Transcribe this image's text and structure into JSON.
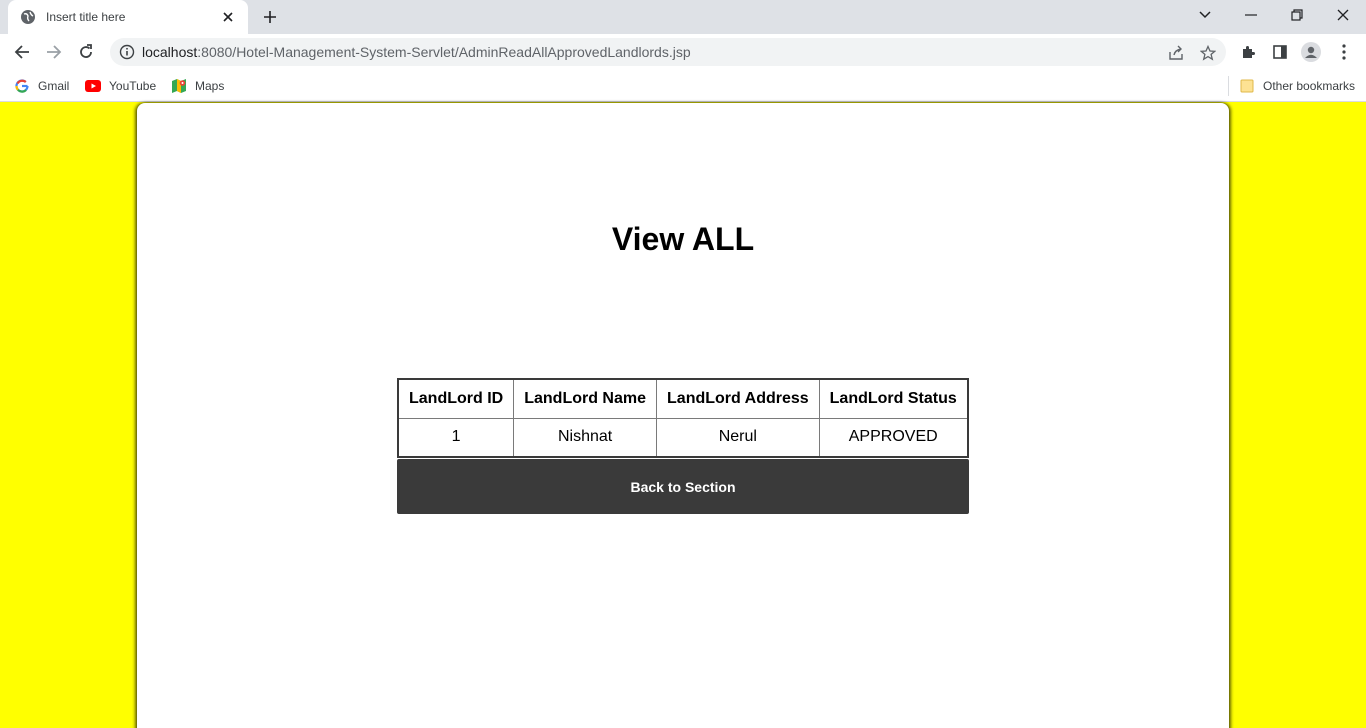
{
  "browser": {
    "tab_title": "Insert title here",
    "url_host": "localhost",
    "url_rest": ":8080/Hotel-Management-System-Servlet/AdminReadAllApprovedLandlords.jsp",
    "bookmarks": [
      "Gmail",
      "YouTube",
      "Maps"
    ],
    "other_bookmarks": "Other bookmarks"
  },
  "page": {
    "title": "View ALL",
    "table": {
      "headers": [
        "LandLord ID",
        "LandLord Name",
        "LandLord Address",
        "LandLord Status"
      ],
      "rows": [
        [
          "1",
          "Nishnat",
          "Nerul",
          "APPROVED"
        ]
      ]
    },
    "back_button_label": "Back to Section"
  },
  "colors": {
    "page_background": "#ffff00",
    "card_background": "#ffffff",
    "button_background": "#3a3a3a",
    "button_text": "#ffffff"
  }
}
